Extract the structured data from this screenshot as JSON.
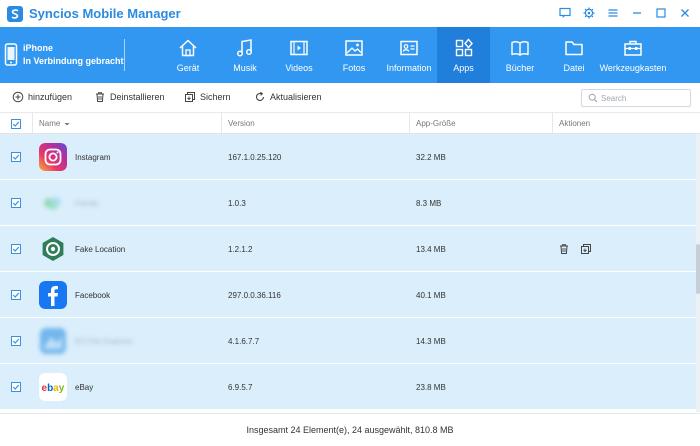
{
  "app": {
    "title": "Syncios Mobile Manager"
  },
  "device": {
    "name": "iPhone",
    "status": "In Verbindung gebracht"
  },
  "nav": [
    {
      "label": "Gerät",
      "icon": "home-icon",
      "active": false
    },
    {
      "label": "Musik",
      "icon": "music-icon",
      "active": false
    },
    {
      "label": "Videos",
      "icon": "video-icon",
      "active": false
    },
    {
      "label": "Fotos",
      "icon": "photo-icon",
      "active": false
    },
    {
      "label": "Information",
      "icon": "contact-card-icon",
      "active": false
    },
    {
      "label": "Apps",
      "icon": "apps-icon",
      "active": true
    },
    {
      "label": "Bücher",
      "icon": "book-icon",
      "active": false
    },
    {
      "label": "Datei",
      "icon": "folder-icon",
      "active": false
    },
    {
      "label": "Werkzeugkasten",
      "icon": "toolbox-icon",
      "active": false
    }
  ],
  "toolbar": {
    "add": "hinzufügen",
    "uninstall": "Deinstallieren",
    "backup": "Sichern",
    "refresh": "Aktualisieren",
    "search_placeholder": "Search"
  },
  "table": {
    "columns": {
      "name": "Name",
      "version": "Version",
      "size": "App-Größe",
      "actions": "Aktionen"
    },
    "rows": [
      {
        "name": "Instagram",
        "version": "167.1.0.25.120",
        "size": "32.2 MB",
        "icon": "instagram-icon",
        "checked": true
      },
      {
        "name": "Family",
        "version": "1.0.3",
        "size": "8.3 MB",
        "icon": "blurred-app-icon",
        "checked": true,
        "blurred": true
      },
      {
        "name": "Fake Location",
        "version": "1.2.1.2",
        "size": "13.4 MB",
        "icon": "fake-location-icon",
        "checked": true
      },
      {
        "name": "Facebook",
        "version": "297.0.0.36.116",
        "size": "40.1 MB",
        "icon": "facebook-icon",
        "checked": true
      },
      {
        "name": "ES File Explorer",
        "version": "4.1.6.7.7",
        "size": "14.3 MB",
        "icon": "blurred-app-icon",
        "checked": true,
        "blurred": true
      },
      {
        "name": "eBay",
        "version": "6.9.5.7",
        "size": "23.8 MB",
        "icon": "ebay-icon",
        "checked": true
      }
    ]
  },
  "status": {
    "summary": "Insgesamt 24 Element(e), 24 ausgewählt, 810.8 MB"
  },
  "colors": {
    "accent": "#3297f0",
    "active_tab": "#1f7fdb",
    "row_selected": "#dbeefb",
    "title_text": "#2a8be0"
  }
}
